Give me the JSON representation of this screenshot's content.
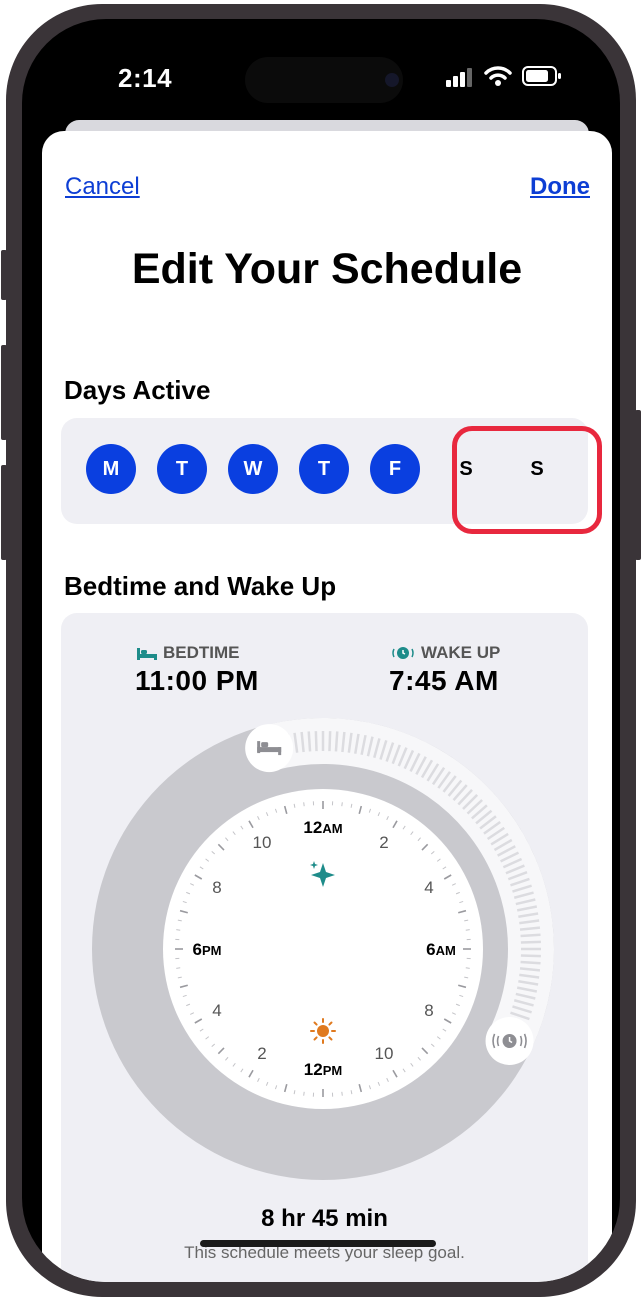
{
  "status_bar": {
    "time": "2:14"
  },
  "nav": {
    "cancel_label": "Cancel",
    "done_label": "Done"
  },
  "page_title": "Edit Your Schedule",
  "days_section": {
    "title": "Days Active",
    "days": [
      {
        "label": "M",
        "active": true
      },
      {
        "label": "T",
        "active": true
      },
      {
        "label": "W",
        "active": true
      },
      {
        "label": "T",
        "active": true
      },
      {
        "label": "F",
        "active": true
      },
      {
        "label": "S",
        "active": false
      },
      {
        "label": "S",
        "active": false
      }
    ]
  },
  "sleep_section": {
    "title": "Bedtime and Wake Up",
    "bedtime_label": "BEDTIME",
    "bedtime_value": "11:00 PM",
    "wake_label": "WAKE UP",
    "wake_value": "7:45 AM",
    "clock_labels": {
      "top": "12",
      "top_suffix": "AM",
      "right": "6",
      "right_suffix": "AM",
      "bottom": "12",
      "bottom_suffix": "PM",
      "left": "6",
      "left_suffix": "PM",
      "h2": "2",
      "h4": "4",
      "h8": "8",
      "h10": "10"
    },
    "duration": "8 hr 45 min",
    "goal_text": "This schedule meets your sleep goal."
  },
  "colors": {
    "accent": "#0a3fe0",
    "highlight": "#e8283e",
    "link": "#0d3ed4",
    "bed_icon": "#1e8c8a",
    "sun": "#e07a1f"
  }
}
